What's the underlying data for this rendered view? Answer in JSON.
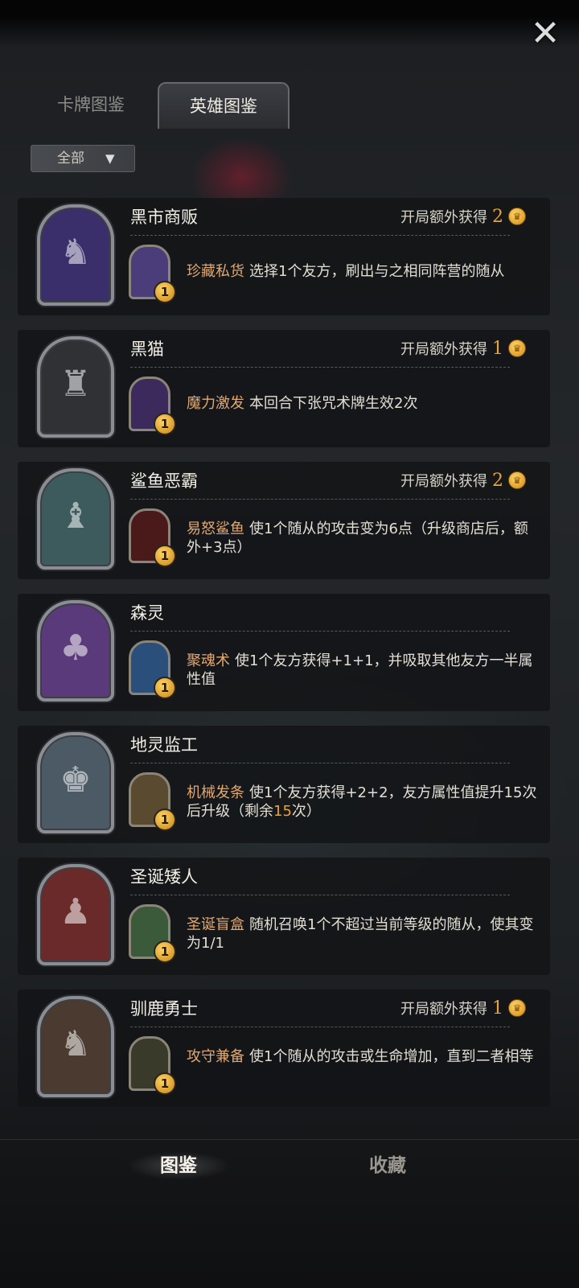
{
  "close_icon": "close-x-icon",
  "tabs": [
    {
      "label": "卡牌图鉴",
      "active": false
    },
    {
      "label": "英雄图鉴",
      "active": true
    }
  ],
  "filter": {
    "label": "全部",
    "icon": "funnel-icon"
  },
  "heroes": [
    {
      "name": "黑市商贩",
      "extra_label": "开局额外获得",
      "extra_value": "2",
      "skill_cost": "1",
      "skill_name": "珍藏私货",
      "skill_desc": "选择1个友方，刷出与之相同阵营的随从",
      "portrait_color": "#3a2f6a",
      "skill_color": "#4b3d7a"
    },
    {
      "name": "黑猫",
      "extra_label": "开局额外获得",
      "extra_value": "1",
      "skill_cost": "1",
      "skill_name": "魔力激发",
      "skill_desc": "本回合下张咒术牌生效2次",
      "portrait_color": "#2f3135",
      "skill_color": "#3d2a5c"
    },
    {
      "name": "鲨鱼恶霸",
      "extra_label": "开局额外获得",
      "extra_value": "2",
      "skill_cost": "1",
      "skill_name": "易怒鲨鱼",
      "skill_desc": "使1个随从的攻击变为6点（升级商店后，额外+3点）",
      "portrait_color": "#3d5a5c",
      "skill_color": "#4a1a1a"
    },
    {
      "name": "森灵",
      "extra_label": "",
      "extra_value": "",
      "skill_cost": "1",
      "skill_name": "聚魂术",
      "skill_desc": "使1个友方获得+1+1，并吸取其他友方一半属性值",
      "portrait_color": "#5a3a7a",
      "skill_color": "#2a4f7a"
    },
    {
      "name": "地灵监工",
      "extra_label": "",
      "extra_value": "",
      "skill_cost": "1",
      "skill_name": "机械发条",
      "skill_desc_a": "使1个友方获得+2+2，友方属性值提升",
      "skill_desc_b": "15",
      "skill_desc_c": "次后升级（剩余",
      "skill_desc_d": "15",
      "skill_desc_e": "次）",
      "portrait_color": "#4c5a66",
      "skill_color": "#5a4a30"
    },
    {
      "name": "圣诞矮人",
      "extra_label": "",
      "extra_value": "",
      "skill_cost": "1",
      "skill_name": "圣诞盲盒",
      "skill_desc": "随机召唤1个不超过当前等级的随从，使其变为1/1",
      "portrait_color": "#6a2a2a",
      "skill_color": "#3a5a3a"
    },
    {
      "name": "驯鹿勇士",
      "extra_label": "开局额外获得",
      "extra_value": "1",
      "skill_cost": "1",
      "skill_name": "攻守兼备",
      "skill_desc": "使1个随从的攻击或生命增加，直到二者相等",
      "portrait_color": "#4a3a30",
      "skill_color": "#3a3a2a"
    }
  ],
  "bottom_tabs": [
    {
      "label": "图鉴",
      "active": true
    },
    {
      "label": "收藏",
      "active": false
    }
  ]
}
